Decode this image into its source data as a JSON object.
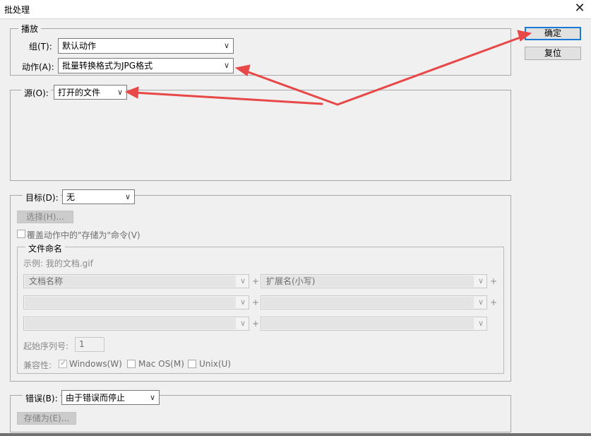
{
  "window": {
    "title": "批处理",
    "close_label": "X"
  },
  "buttons": {
    "ok": "确定",
    "reset": "复位"
  },
  "play": {
    "legend": "播放",
    "group_label": "组(T):",
    "group_value": "默认动作",
    "action_label": "动作(A):",
    "action_value": "批量转换格式为JPG格式"
  },
  "source": {
    "label": "源(O):",
    "value": "打开的文件"
  },
  "destination": {
    "label": "目标(D):",
    "value": "无",
    "choose_button": "选择(H)...",
    "override_label": "覆盖动作中的\"存储为\"命令(V)"
  },
  "file_naming": {
    "legend": "文件命名",
    "example": "示例: 我的文档.gif",
    "rows": [
      {
        "left": "文档名称",
        "right": "扩展名(小写)"
      },
      {
        "left": "",
        "right": ""
      },
      {
        "left": "",
        "right": ""
      }
    ],
    "plus": "+",
    "serial_label": "起始序列号:",
    "serial_value": "1",
    "compat_label": "兼容性:",
    "compat_windows": "Windows(W)",
    "compat_mac": "Mac OS(M)",
    "compat_unix": "Unix(U)",
    "windows_checked": true
  },
  "errors": {
    "label": "错误(B):",
    "value": "由于错误而停止",
    "save_as_button": "存储为(E)..."
  },
  "icons": {
    "dropdown": "chevron-down-icon",
    "close": "close-icon",
    "checkmark": "check-icon"
  },
  "colors": {
    "annotation_arrow": "#e84848",
    "ok_border": "#1a7ad4"
  }
}
